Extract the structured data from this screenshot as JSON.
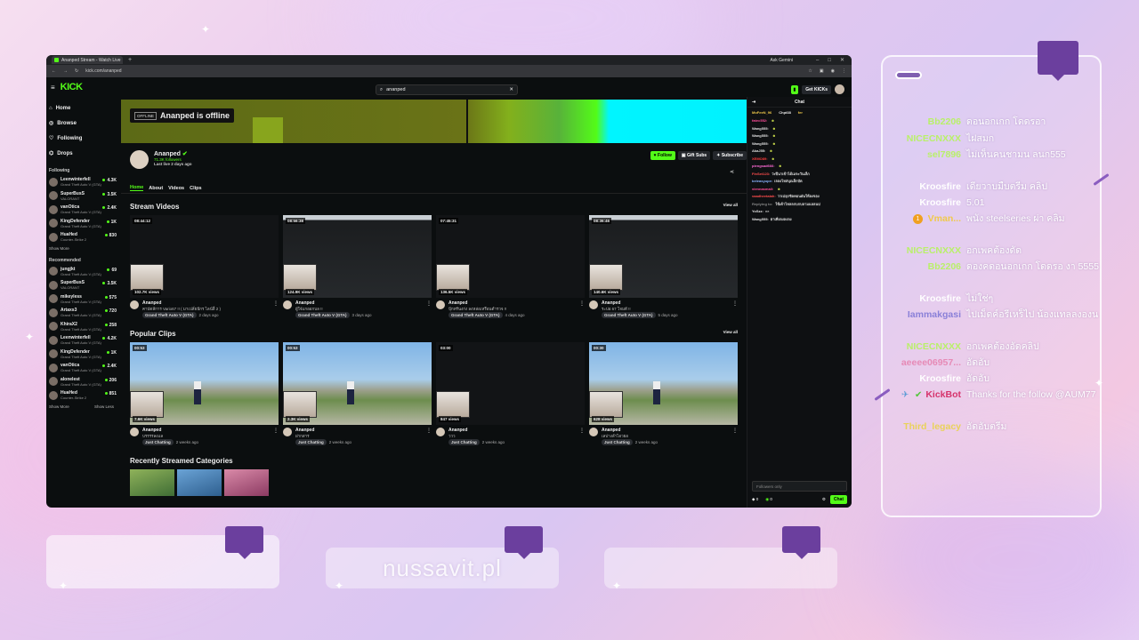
{
  "browser": {
    "tab_title": "Ananped Stream - Watch Live",
    "ask_tab": "Ask Gemini",
    "url": "kick.com/ananped",
    "window_min": "–",
    "window_max": "□",
    "window_close": "✕",
    "new_tab": "+"
  },
  "kick": {
    "logo": "KICK",
    "search_value": "ananped",
    "get_kick": "Get KICKs",
    "nav": [
      "Home",
      "Browse",
      "Following",
      "Drops"
    ],
    "following_label": "Following",
    "following": [
      {
        "name": "Leenwinterfell",
        "game": "Grand Theft Auto V (GTA)",
        "viewers": "4.3K"
      },
      {
        "name": "SuperBusS",
        "game": "VALORANT",
        "viewers": "3.5K"
      },
      {
        "name": "vanOtica",
        "game": "Grand Theft Auto V (GTA)",
        "viewers": "2.4K"
      },
      {
        "name": "KingDefender",
        "game": "Grand Theft Auto V (GTA)",
        "viewers": "1K"
      },
      {
        "name": "HuaHed",
        "game": "Counter-Strike 2",
        "viewers": "830"
      }
    ],
    "show_more": "Show More",
    "recommended_label": "Recommended",
    "recommended": [
      {
        "name": "jungjkt",
        "game": "Grand Theft Auto V (GTA)",
        "viewers": "69"
      },
      {
        "name": "SuperBusS",
        "game": "VALORANT",
        "viewers": "3.5K"
      },
      {
        "name": "mikeyless",
        "game": "Grand Theft Auto V (GTA)",
        "viewers": "575"
      },
      {
        "name": "Artaxs3",
        "game": "Grand Theft Auto V (GTA)",
        "viewers": "720"
      },
      {
        "name": "KhiraX2",
        "game": "Grand Theft Auto V (GTA)",
        "viewers": "258"
      },
      {
        "name": "Leenwinterfell",
        "game": "Grand Theft Auto V (GTA)",
        "viewers": "4.2K"
      },
      {
        "name": "KingDefender",
        "game": "Grand Theft Auto V (GTA)",
        "viewers": "1K"
      },
      {
        "name": "vanOtica",
        "game": "Grand Theft Auto V (GTA)",
        "viewers": "2.4K"
      },
      {
        "name": "alonelest",
        "game": "Grand Theft Auto V (GTA)",
        "viewers": "206"
      },
      {
        "name": "HuaHed",
        "game": "Counter-Strike 2",
        "viewers": "851"
      }
    ],
    "show_more2": "Show More",
    "show_less": "Show Less",
    "offline_tag": "OFFLINE",
    "offline_text": "Ananped is offline",
    "channel_name": "Ananped",
    "followers": "71.3K followers",
    "last_live": "Last live 2 days ago",
    "follow": "Follow",
    "gift": "Gift Subs",
    "subscribe": "Subscribe",
    "tabs": [
      "Home",
      "About",
      "Videos",
      "Clips"
    ],
    "stream_videos_title": "Stream Videos",
    "view_all": "View all",
    "videos": [
      {
        "dur": "08:44:12",
        "views": "102.7K views",
        "title": "คาบัดลีการ Vario67 !! ( มาเปลี่ยนีกร ไลน์ลื่ 2 )",
        "cat": "Grand Theft Auto V (GTA)",
        "ago": "2 days ago"
      },
      {
        "dur": "08:56:38",
        "views": "124.9K views",
        "title": "ผู้ใจ๋แกออกบล !!",
        "cat": "Grand Theft Auto V (GTA)",
        "ago": "3 days ago"
      },
      {
        "dur": "07:45:31",
        "views": "136.5K views",
        "title": "ปุ้กทรีนงก่ง ลงหล่อเหรือนตำรวจ !!",
        "cat": "Grand Theft Auto V (GTA)",
        "ago": "4 days ago"
      },
      {
        "dur": "08:36:46",
        "views": "140.6K views",
        "title": "ระบ่อ 67 โจมตี !!",
        "cat": "Grand Theft Auto V (GTA)",
        "ago": "5 days ago"
      }
    ],
    "clips_title": "Popular Clips",
    "clips": [
      {
        "dur": "00:53",
        "views": "7.6K views",
        "title": "บรรรรลงแล",
        "cat": "Just Chatting",
        "ago": "2 weeks ago"
      },
      {
        "dur": "00:53",
        "views": "2.3K views",
        "title": "ฝากสาร",
        "cat": "Just Chatting",
        "ago": "2 weeks ago"
      },
      {
        "dur": "03:00",
        "views": "847 views",
        "title": "ววว",
        "cat": "Just Chatting",
        "ago": "2 weeks ago"
      },
      {
        "dur": "00:30",
        "views": "628 views",
        "title": "เลปางลำไอวยอ",
        "cat": "Just Chatting",
        "ago": "2 weeks ago"
      }
    ],
    "categories_title": "Recently Streamed Categories",
    "chat_title": "Chat",
    "chat_top": [
      "MoFeeN_96",
      "Chpt38",
      "fer"
    ],
    "chat_msgs": [
      {
        "u": "fatec552:",
        "c": "#ff4d9a",
        "t": ""
      },
      {
        "u": "Wang555:",
        "c": "#e0e0e0",
        "t": ""
      },
      {
        "u": "Wang555:",
        "c": "#e0e0e0",
        "t": ""
      },
      {
        "u": "Wang555:",
        "c": "#e0e0e0",
        "t": ""
      },
      {
        "u": "AkaJ55:",
        "c": "#e0e0e0",
        "t": ""
      },
      {
        "u": "XEMO89:",
        "c": "#ff3b3b",
        "t": ""
      },
      {
        "u": "piengsad666:",
        "c": "#ff6ad5",
        "t": ""
      },
      {
        "u": "FinSet123:",
        "c": "#ff4d4d",
        "t": "ว่ะปีนาเข้าได้เมจะวันเล็ก"
      },
      {
        "u": "beleasyupe:",
        "c": "#8ab4ff",
        "t": "เจลงไหล่บุณล็กบัต"
      },
      {
        "u": "viennasmail:",
        "c": "#ff4d9a",
        "t": ""
      },
      {
        "u": "vaadheetalah:",
        "c": "#ff4d4d",
        "t": "วาเปลุกชิลคอนฝ่นให้ลงจอง"
      },
      {
        "u": "Replying to: ",
        "c": "#888",
        "t": "ใช้เค้าไหลลกบกบลามแลลนบ่"
      },
      {
        "u": "YoSzz:",
        "c": "#e0e0e0",
        "t": "××"
      },
      {
        "u": "Wang555:",
        "c": "#e0e0e0",
        "t": "ฮาเพิ่งลงลงลง"
      }
    ],
    "chat_placeholder": "Followers only",
    "chat_count_a": "0",
    "chat_count_b": "0",
    "chat_send": "Chat"
  },
  "overlay_chat": [
    {
      "name": "Bb2206",
      "color": "#b9f06a",
      "msg": "ดอนอกเกก โดดรอา"
    },
    {
      "name": "NICECNXXX",
      "color": "#b9f06a",
      "msg": "ไฝสมก"
    },
    {
      "name": "sel7896",
      "color": "#b9f06a",
      "msg": "ไม่เห็นคนชามน ลนก555"
    },
    {
      "name": "Kroosfire",
      "color": "#ffffff",
      "msg": "เดียวาบมืบตรีม คลิป"
    },
    {
      "name": "Kroosfire",
      "color": "#ffffff",
      "msg": "5.01"
    },
    {
      "name": "Vman...",
      "color": "#f0c94a",
      "msg": "พนัง steelseries ผ่า คลิม",
      "badge": "1"
    },
    {
      "name": "NICECNXXX",
      "color": "#b9f06a",
      "msg": "อกเพคต้องดัด"
    },
    {
      "name": "Bb2206",
      "color": "#b9f06a",
      "msg": "ดองคดอนอกเกก โดดรอ งา 5555"
    },
    {
      "name": "Kroosfire",
      "color": "#ffffff",
      "msg": "ไม่ใช่ๆ"
    },
    {
      "name": "Iammakgasi",
      "color": "#8a80d8",
      "msg": "ไปเม็ดค์อรีเหร็ไป น้องแทลลงองน"
    },
    {
      "name": "NICECNXXX",
      "color": "#b9f06a",
      "msg": "อกเพคต้องอัดคลิป"
    },
    {
      "name": "aeeee06957...",
      "color": "#e68ab6",
      "msg": "อัดอับ"
    },
    {
      "name": "Kroosfire",
      "color": "#ffffff",
      "msg": "อัดอับ"
    },
    {
      "name": "KickBot",
      "color": "#d6336c",
      "msg": "Thanks for the follow @AUM77"
    },
    {
      "name": "Third_legacy",
      "color": "#e9d25a",
      "msg": "อัดอับตรีม"
    }
  ],
  "bottom_boxes": [
    "",
    "nussavit.pl",
    ""
  ],
  "colors": {
    "kick_green": "#53fc18",
    "bubble": "#6b3f9e"
  }
}
